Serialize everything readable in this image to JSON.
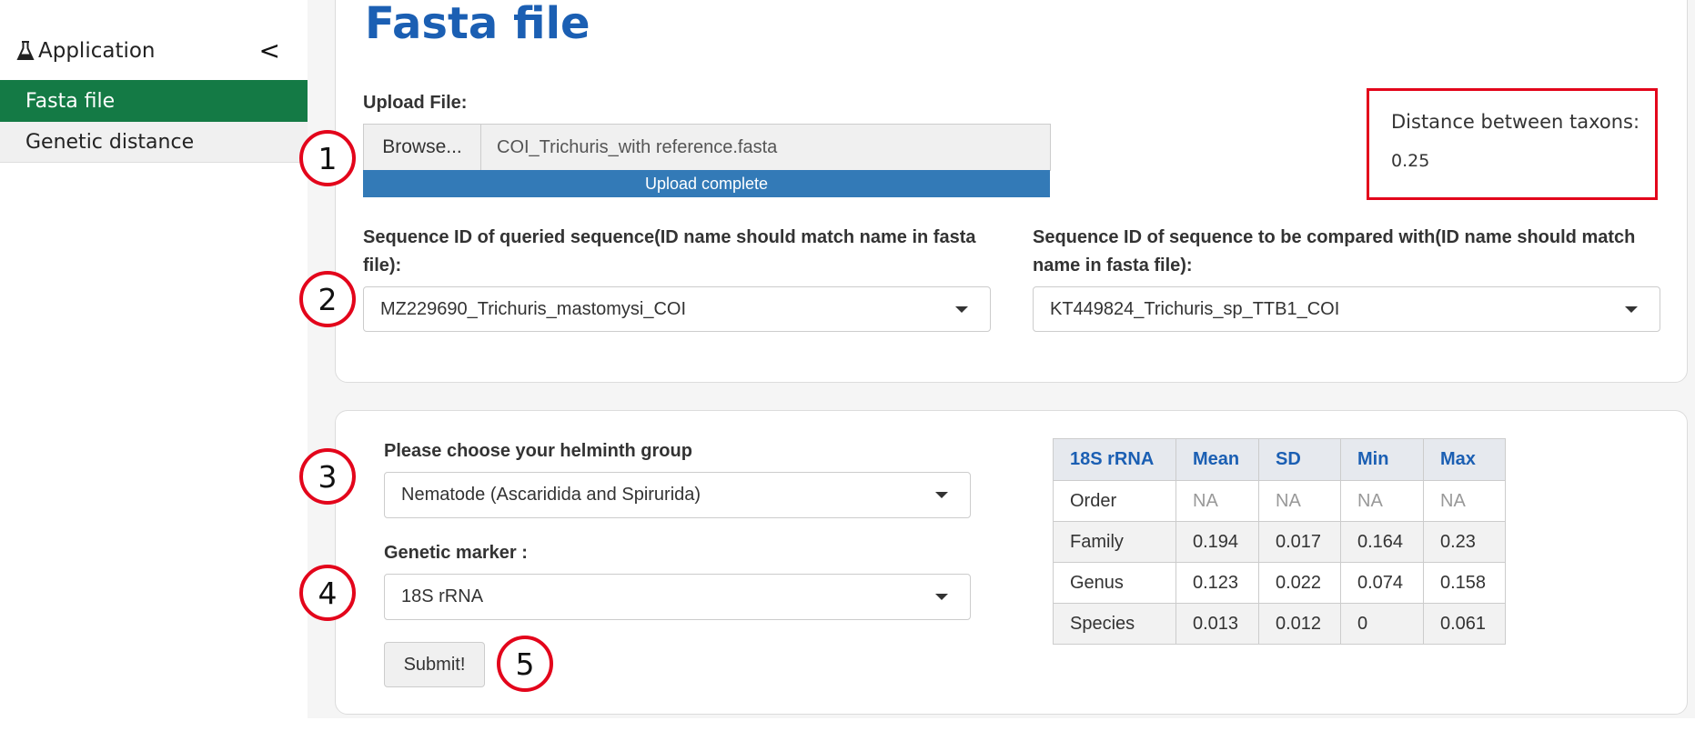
{
  "sidebar": {
    "header_label": "Application",
    "collapse_label": "<",
    "items": [
      {
        "label": "Fasta file",
        "active": true
      },
      {
        "label": "Genetic distance",
        "active": false
      }
    ]
  },
  "page": {
    "title": "Fasta file"
  },
  "upload": {
    "label": "Upload File:",
    "browse_label": "Browse...",
    "file_name": "COI_Trichuris_with reference.fasta",
    "status": "Upload complete",
    "progress_percent": 100
  },
  "query_sequence": {
    "label": "Sequence ID of queried sequence(ID name should match name in fasta file):",
    "selected": "MZ229690_Trichuris_mastomysi_COI"
  },
  "compare_sequence": {
    "label": "Sequence ID of sequence to be compared with(ID name should match name in fasta file):",
    "selected": "KT449824_Trichuris_sp_TTB1_COI"
  },
  "distance": {
    "title": "Distance between taxons:",
    "value": "0.25"
  },
  "helminth_group": {
    "label": "Please choose your helminth group",
    "selected": "Nematode (Ascaridida and Spirurida)"
  },
  "genetic_marker": {
    "label": "Genetic marker :",
    "selected": "18S rRNA"
  },
  "submit_label": "Submit!",
  "callouts": [
    "1",
    "2",
    "3",
    "4",
    "5"
  ],
  "stats_table": {
    "headers": [
      "18S rRNA",
      "Mean",
      "SD",
      "Min",
      "Max"
    ],
    "rows": [
      [
        "Order",
        "NA",
        "NA",
        "NA",
        "NA"
      ],
      [
        "Family",
        "0.194",
        "0.017",
        "0.164",
        "0.23"
      ],
      [
        "Genus",
        "0.123",
        "0.022",
        "0.074",
        "0.158"
      ],
      [
        "Species",
        "0.013",
        "0.012",
        "0",
        "0.061"
      ]
    ]
  },
  "colors": {
    "active_nav": "#147a45",
    "title": "#1b5fb3",
    "progress": "#337ab7",
    "callout_ring": "#e3051b"
  }
}
